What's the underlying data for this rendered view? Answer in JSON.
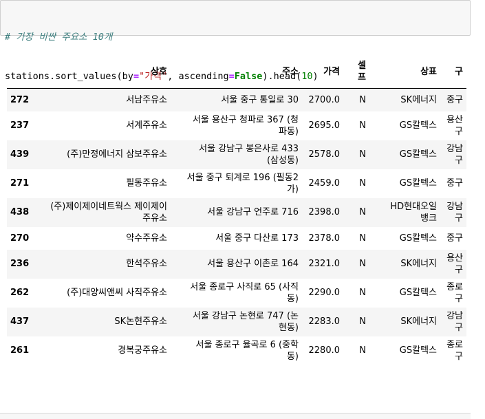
{
  "code": {
    "comment": "# 가장 비싼 주요소 10개",
    "var": "stations.sort_values(by",
    "eq1": "=",
    "str": "\"가격\"",
    "mid": ", ascending",
    "eq2": "=",
    "kw": "False",
    "tail1": ").head(",
    "num": "10",
    "tail2": ")"
  },
  "table": {
    "columns": [
      "",
      "상호",
      "주소",
      "가격",
      "셀\n프",
      "상표",
      "구"
    ],
    "rows": [
      {
        "idx": "272",
        "name": "서남주유소",
        "addr": "서울 중구 통일로 30",
        "price": "2700.0",
        "self": "N",
        "brand": "SK에너지",
        "gu": "중구"
      },
      {
        "idx": "237",
        "name": "서계주유소",
        "addr": "서울 용산구 청파로 367 (청\n파동)",
        "price": "2695.0",
        "self": "N",
        "brand": "GS칼텍스",
        "gu": "용산\n구"
      },
      {
        "idx": "439",
        "name": "(주)만정에너지 삼보주유소",
        "addr": "서울 강남구 봉은사로 433\n(삼성동)",
        "price": "2578.0",
        "self": "N",
        "brand": "GS칼텍스",
        "gu": "강남\n구"
      },
      {
        "idx": "271",
        "name": "필동주유소",
        "addr": "서울 중구 퇴계로 196 (필동2\n가)",
        "price": "2459.0",
        "self": "N",
        "brand": "GS칼텍스",
        "gu": "중구"
      },
      {
        "idx": "438",
        "name": "(주)제이제이네트웍스 제이제이\n주유소",
        "addr": "서울 강남구 언주로 716",
        "price": "2398.0",
        "self": "N",
        "brand": "HD현대오일\n뱅크",
        "gu": "강남\n구"
      },
      {
        "idx": "270",
        "name": "약수주유소",
        "addr": "서울 중구 다산로 173",
        "price": "2378.0",
        "self": "N",
        "brand": "GS칼텍스",
        "gu": "중구"
      },
      {
        "idx": "236",
        "name": "한석주유소",
        "addr": "서울 용산구 이촌로 164",
        "price": "2321.0",
        "self": "N",
        "brand": "SK에너지",
        "gu": "용산\n구"
      },
      {
        "idx": "262",
        "name": "(주)대양씨앤씨 사직주유소",
        "addr": "서울 종로구 사직로 65 (사직\n동)",
        "price": "2290.0",
        "self": "N",
        "brand": "GS칼텍스",
        "gu": "종로\n구"
      },
      {
        "idx": "437",
        "name": "SK논현주유소",
        "addr": "서울 강남구 논현로 747 (논\n현동)",
        "price": "2283.0",
        "self": "N",
        "brand": "SK에너지",
        "gu": "강남\n구"
      },
      {
        "idx": "261",
        "name": "경복궁주유소",
        "addr": "서울 종로구 율곡로 6 (중학\n동)",
        "price": "2280.0",
        "self": "N",
        "brand": "GS칼텍스",
        "gu": "종로\n구"
      }
    ]
  }
}
